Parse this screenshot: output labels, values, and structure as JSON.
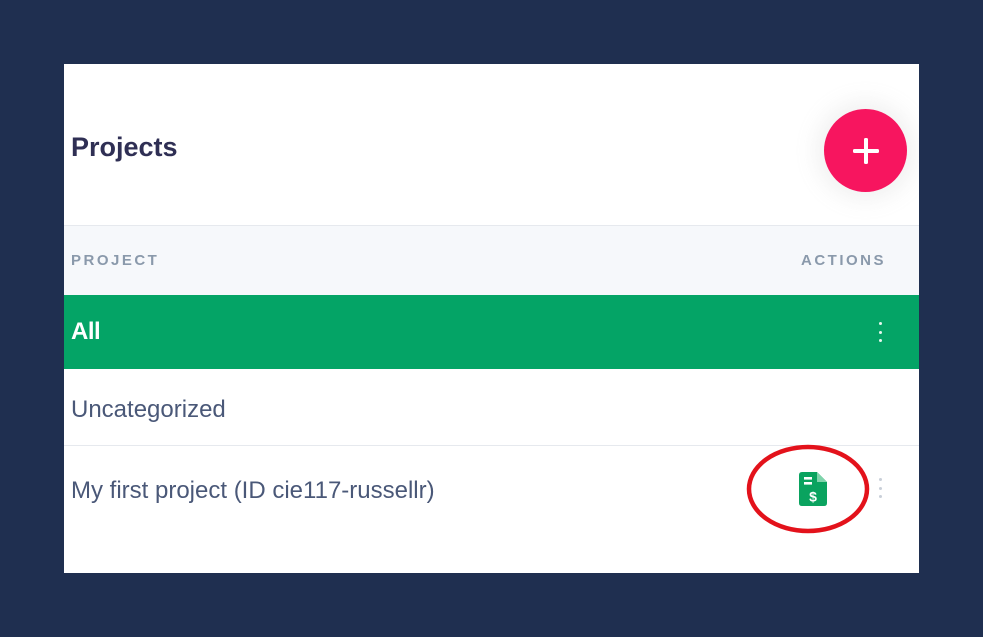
{
  "header": {
    "title": "Projects",
    "add_icon": "plus-icon",
    "accent_color": "#f7155f"
  },
  "table": {
    "columns": [
      "PROJECT",
      "ACTIONS"
    ],
    "rows": [
      {
        "label": "All",
        "selected": true,
        "menu_icon": "more-vertical-icon"
      },
      {
        "label": "Uncategorized",
        "selected": false
      },
      {
        "label": "My first project (ID cie117-russellr)",
        "selected": false,
        "action_icon": "billing-document-icon",
        "menu_icon": "more-vertical-icon"
      }
    ]
  },
  "colors": {
    "background": "#1f2f50",
    "selected_row": "#04a466",
    "billing_icon": "#0aa35f",
    "annotation": "#e3121b"
  }
}
